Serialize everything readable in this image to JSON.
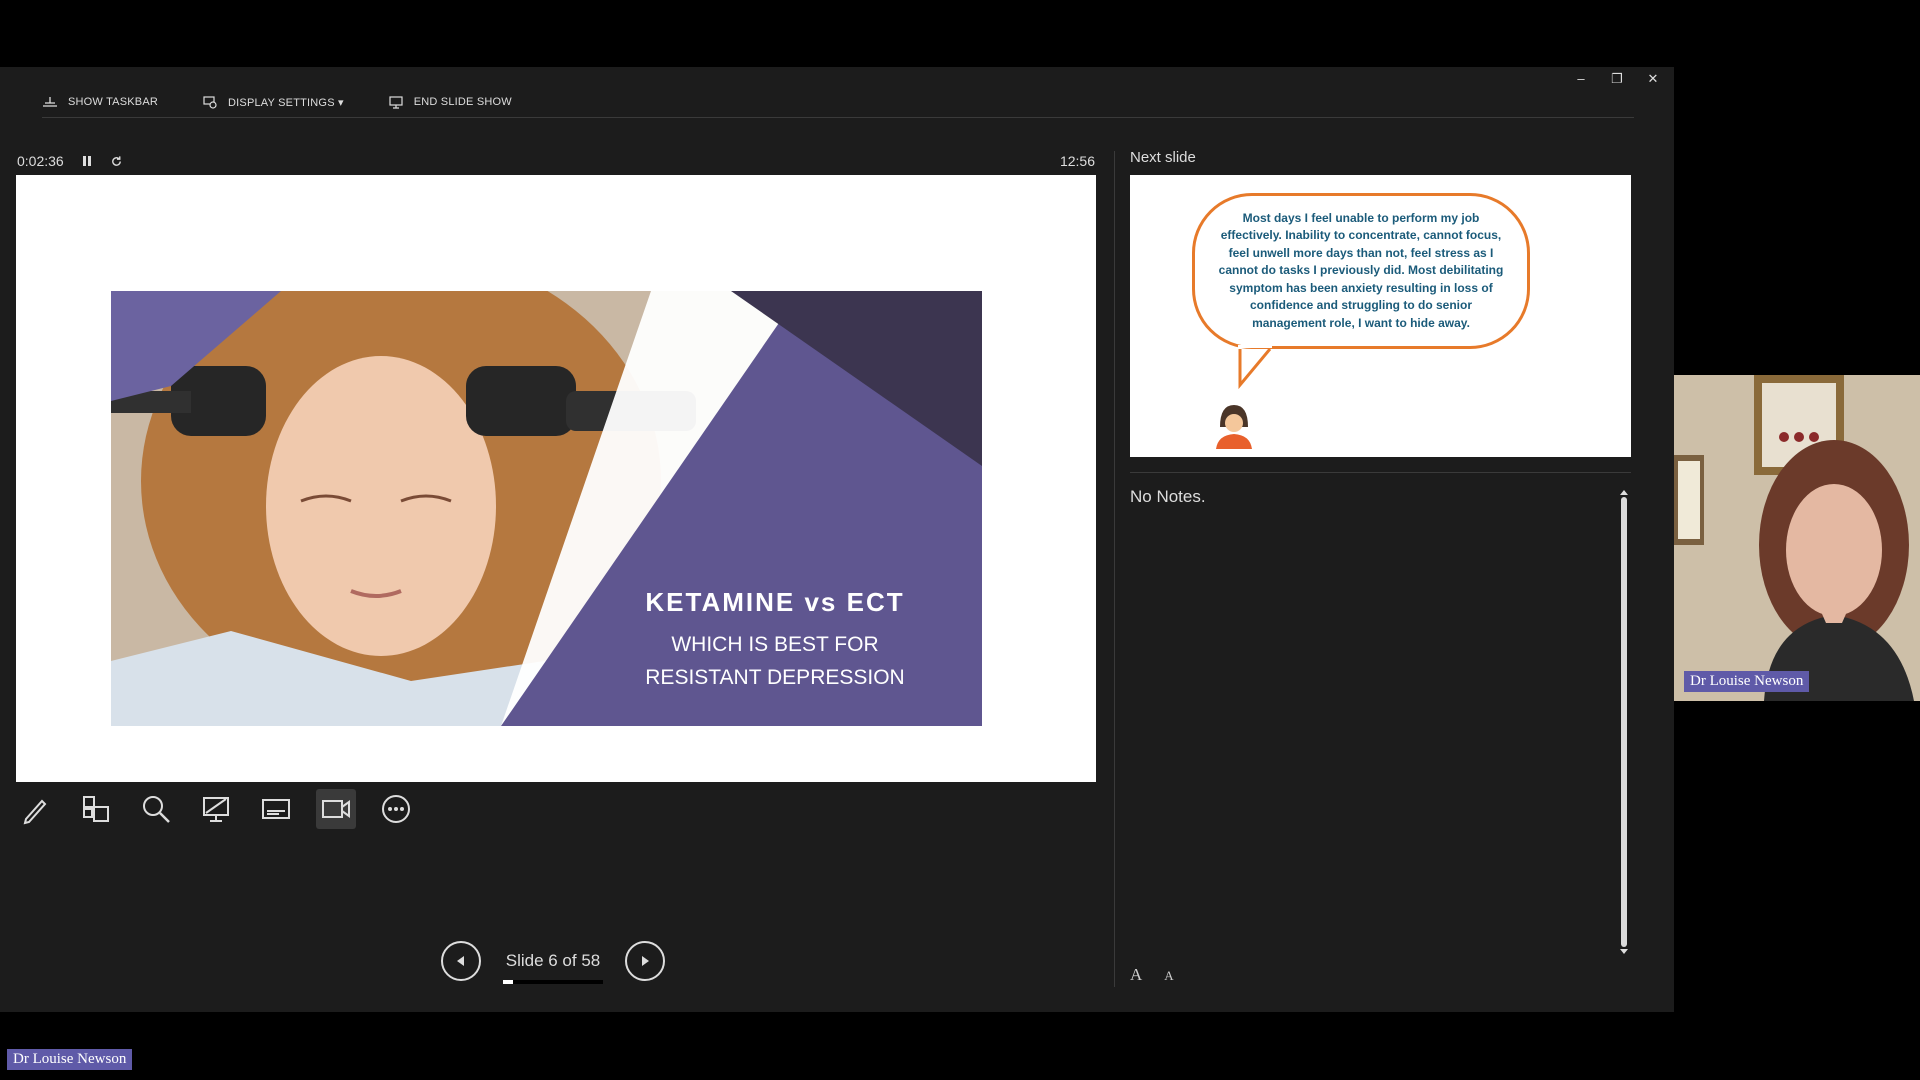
{
  "toolbar": {
    "show_taskbar": "SHOW TASKBAR",
    "display_settings": "DISPLAY SETTINGS ▾",
    "end_slide_show": "END SLIDE SHOW"
  },
  "window_controls": {
    "minimize": "–",
    "restore": "❐",
    "close": "✕"
  },
  "timer": {
    "elapsed": "0:02:36",
    "clock": "12:56"
  },
  "current_slide": {
    "title": "KETAMINE vs ECT",
    "subtitle_line1": "WHICH IS BEST FOR",
    "subtitle_line2": "RESISTANT DEPRESSION"
  },
  "tools": [
    "pen-icon",
    "see-all-slides-icon",
    "zoom-icon",
    "pointer-screen-icon",
    "subtitles-icon",
    "camera-icon",
    "more-options-icon"
  ],
  "navigation": {
    "slide_label": "Slide 6 of 58",
    "current": 6,
    "total": 58
  },
  "next_slide": {
    "label": "Next slide",
    "quote": "Most days I feel unable to perform my job effectively. Inability to concentrate, cannot focus, feel unwell more days than not, feel stress as I cannot do tasks I previously did. Most debilitating symptom has been anxiety resulting in loss of confidence and struggling to do senior management role, I want to hide away."
  },
  "notes": {
    "text": "No Notes."
  },
  "font_controls": {
    "increase": "A",
    "decrease": "A"
  },
  "participants": {
    "webcam_name": "Dr Louise Newson",
    "footer_name": "Dr Louise Newson"
  },
  "colors": {
    "panel_bg": "#1c1c1c",
    "slide_purple": "#5f5690",
    "bubble_orange": "#e77a2a",
    "bubble_text": "#1b5b7a",
    "name_tag": "#5f5aa8"
  }
}
